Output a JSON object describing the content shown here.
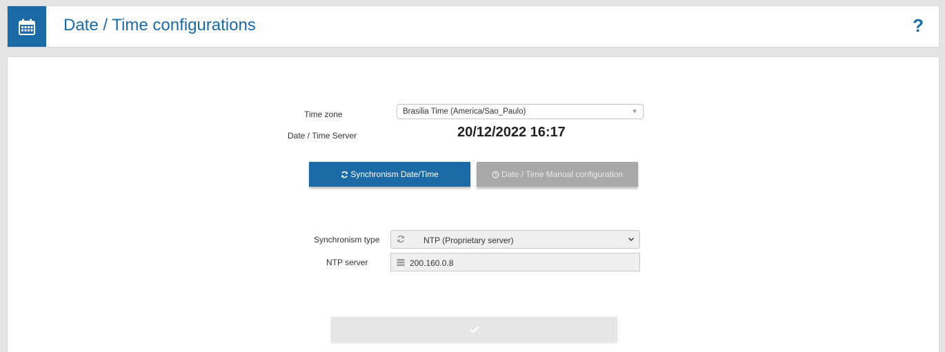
{
  "header": {
    "title": "Date / Time configurations",
    "help_label": "?"
  },
  "form": {
    "timezone_label": "Time zone",
    "timezone_value": "Brasilia Time (America/Sao_Paulo)",
    "server_label": "Date / Time Server",
    "server_datetime": "20/12/2022 16:17",
    "sync_button_label": "Synchronism Date/Time",
    "manual_button_label": "Date / Time Manual configuration",
    "sync_type_label": "Synchronism type",
    "sync_type_value": "NTP (Proprietary server)",
    "ntp_server_label": "NTP server",
    "ntp_server_value": "200.160.0.8"
  },
  "colors": {
    "accent": "#1b6aa5",
    "disabled_button": "#a9a9a9",
    "confirm_button": "#e6e6e6"
  },
  "icons": {
    "header": "calendar-icon",
    "help": "question-icon",
    "sync_button": "refresh-icon",
    "manual_button": "clock-icon",
    "sync_type_field": "refresh-icon",
    "ntp_field": "server-icon",
    "confirm": "checkmark-icon"
  }
}
